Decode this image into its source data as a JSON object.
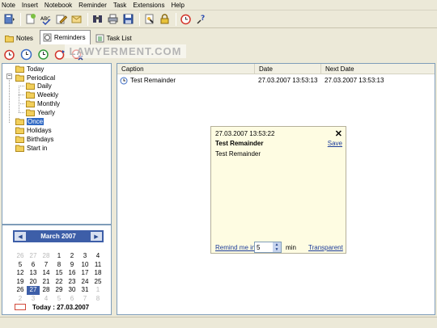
{
  "menu": [
    "Note",
    "Insert",
    "Notebook",
    "Reminder",
    "Task",
    "Extensions",
    "Help"
  ],
  "tabs": [
    {
      "label": "Notes",
      "icon": "folder-icon"
    },
    {
      "label": "Reminders",
      "icon": "reminder-icon",
      "active": true
    },
    {
      "label": "Task List",
      "icon": "task-list-icon"
    }
  ],
  "watermark": "LAWYERMENT.COM",
  "tree": {
    "items": [
      "Today",
      "Periodical",
      "Daily",
      "Weekly",
      "Monthly",
      "Yearly",
      "Once",
      "Holidays",
      "Birthdays",
      "Start in"
    ],
    "selected": "Once",
    "expander": "−"
  },
  "calendar": {
    "title": "March 2007",
    "prev": "◀",
    "next": "▶",
    "weeks": [
      [
        "26",
        "27",
        "28",
        "1",
        "2",
        "3",
        "4"
      ],
      [
        "5",
        "6",
        "7",
        "8",
        "9",
        "10",
        "11"
      ],
      [
        "12",
        "13",
        "14",
        "15",
        "16",
        "17",
        "18"
      ],
      [
        "19",
        "20",
        "21",
        "22",
        "23",
        "24",
        "25"
      ],
      [
        "26",
        "27",
        "28",
        "29",
        "30",
        "31",
        "1"
      ],
      [
        "2",
        "3",
        "4",
        "5",
        "6",
        "7",
        "8"
      ]
    ],
    "today_day": "27",
    "footer_label": "Today",
    "footer_date": ": 27.03.2007"
  },
  "list": {
    "columns": [
      "Caption",
      "Date",
      "Next Date"
    ],
    "rows": [
      {
        "caption": "Test Remainder",
        "date": "27.03.2007 13:53:13",
        "next": "27.03.2007 13:53:13"
      }
    ]
  },
  "popup": {
    "datetime": "27.03.2007 13:53:22",
    "close": "✕",
    "title": "Test Remainder",
    "save": "Save",
    "text": "Test Remainder",
    "remind_label": "Remind me in",
    "minutes": "5",
    "min_unit": "min",
    "transparent": "Transparent"
  },
  "colors": {
    "accent": "#3d5ea8",
    "selection": "#316ac5",
    "popup_bg": "#fefce2"
  }
}
